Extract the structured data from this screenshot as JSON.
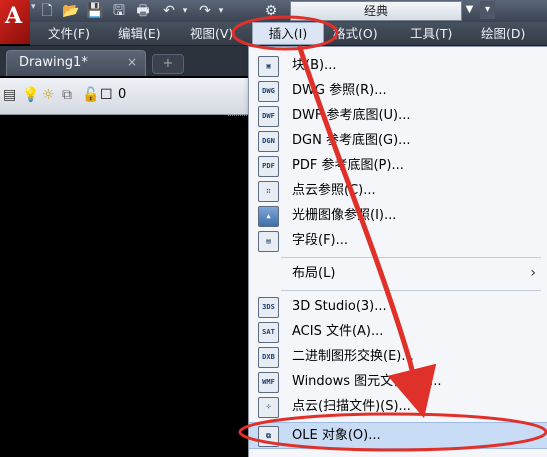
{
  "workspace": {
    "current": "经典"
  },
  "menubar": {
    "items": [
      {
        "label": "文件(F)"
      },
      {
        "label": "编辑(E)"
      },
      {
        "label": "视图(V)"
      },
      {
        "label": "插入(I)"
      },
      {
        "label": "格式(O)"
      },
      {
        "label": "工具(T)"
      },
      {
        "label": "绘图(D)"
      }
    ]
  },
  "tabs": {
    "doc_label": "Drawing1*",
    "close_glyph": "×",
    "new_glyph": "+"
  },
  "layerbar": {
    "layer_name": "0"
  },
  "insert_menu": {
    "items": [
      {
        "label": "块(B)...",
        "icon": "block-icon"
      },
      {
        "label": "DWG 参照(R)...",
        "icon": "dwg-icon",
        "icon_text": "DWG"
      },
      {
        "label": "DWF 参考底图(U)...",
        "icon": "dwf-icon",
        "icon_text": "DWF"
      },
      {
        "label": "DGN 参考底图(G)...",
        "icon": "dgn-icon",
        "icon_text": "DGN"
      },
      {
        "label": "PDF 参考底图(P)...",
        "icon": "pdf-icon",
        "icon_text": "PDF"
      },
      {
        "label": "点云参照(C)...",
        "icon": "point-cloud-icon"
      },
      {
        "label": "光栅图像参照(I)...",
        "icon": "raster-image-icon"
      },
      {
        "label": "字段(F)...",
        "icon": "field-icon"
      },
      {
        "label": "布局(L)",
        "submenu": true
      },
      {
        "label": "3D Studio(3)...",
        "icon": "3ds-icon",
        "icon_text": "3DS"
      },
      {
        "label": "ACIS 文件(A)...",
        "icon": "acis-icon",
        "icon_text": "SAT"
      },
      {
        "label": "二进制图形交换(E)...",
        "icon": "dxb-icon",
        "icon_text": "DXB"
      },
      {
        "label": "Windows 图元文件(W)...",
        "icon": "wmf-icon",
        "icon_text": "WMF"
      },
      {
        "label": "点云(扫描文件)(S)...",
        "icon": "point-cloud-scan-icon"
      },
      {
        "label": "OLE 对象(O)...",
        "icon": "ole-object-icon",
        "highlighted": true
      }
    ],
    "submenu_arrow": "›"
  },
  "colors": {
    "menu_bg": "#f4f6f9",
    "hover_bg": "#c9dcf6",
    "annotation_red": "#e0302a",
    "canvas_bg": "#000000"
  }
}
